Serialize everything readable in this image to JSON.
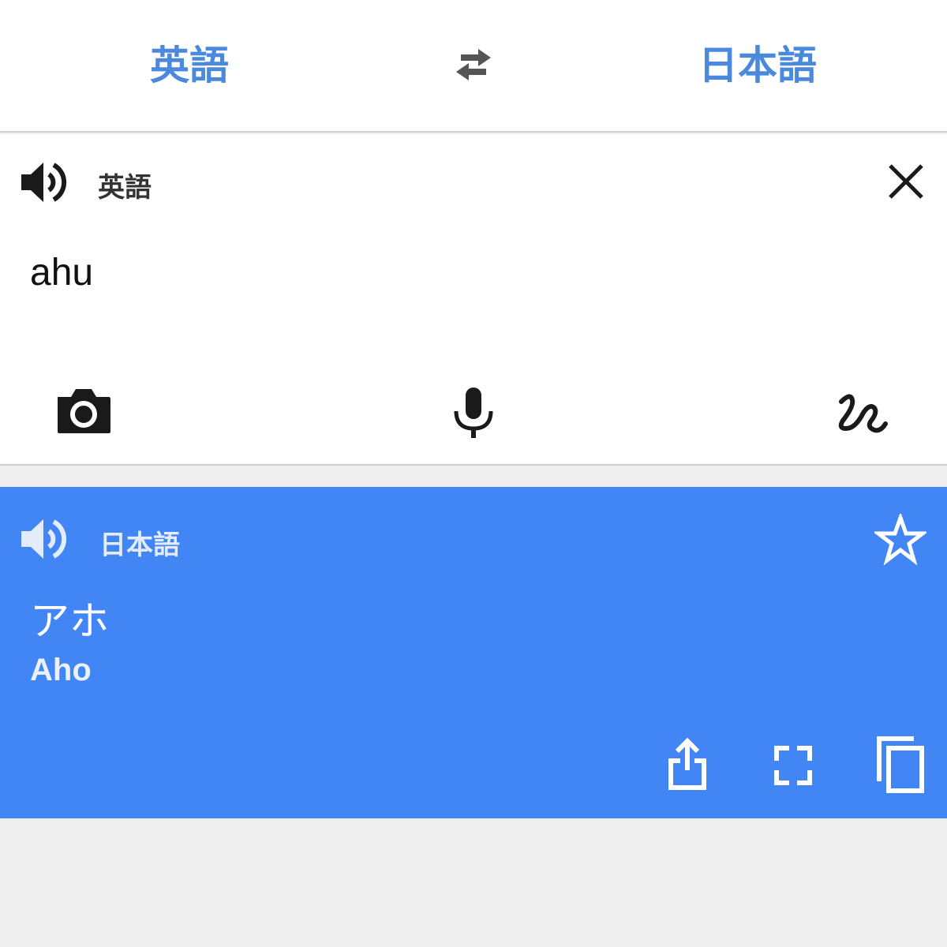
{
  "header": {
    "source_language": "英語",
    "target_language": "日本語",
    "swap_icon": "swap-arrows-icon"
  },
  "input": {
    "language": "英語",
    "text": "ahu",
    "icons": [
      "speaker-icon",
      "close-icon",
      "camera-icon",
      "microphone-icon",
      "handwriting-icon"
    ]
  },
  "result": {
    "language": "日本語",
    "translation": "アホ",
    "romanization": "Aho",
    "icons": [
      "speaker-icon",
      "star-icon",
      "share-icon",
      "fullscreen-icon",
      "copy-icon"
    ]
  },
  "colors": {
    "accent": "#4a89dc",
    "result_background": "#4285f4",
    "page_background": "#eeeeee"
  }
}
